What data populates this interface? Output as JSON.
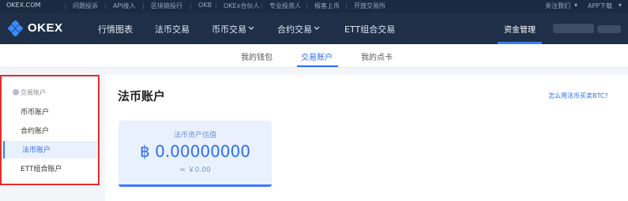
{
  "topbar": {
    "brand": "OKEX.COM",
    "links": [
      "问题投诉",
      "API接入",
      "区块链投行",
      "OKB",
      "OKEx合伙人",
      "专业投资人",
      "极客上币",
      "开放交易所"
    ],
    "follow": "关注我们",
    "app_download": "APP下载"
  },
  "navbar": {
    "logo_text": "OKEX",
    "items": [
      {
        "label": "行情图表"
      },
      {
        "label": "法币交易"
      },
      {
        "label": "币币交易"
      },
      {
        "label": "合约交易"
      },
      {
        "label": "ETT组合交易"
      }
    ],
    "funds_label": "资金管理"
  },
  "subnav": {
    "tabs": [
      {
        "label": "我的钱包"
      },
      {
        "label": "交易账户"
      },
      {
        "label": "我的点卡"
      }
    ],
    "active_tab": "交易账户"
  },
  "sidebar": {
    "header": "交易账户",
    "items": [
      {
        "label": "币币账户"
      },
      {
        "label": "合约账户"
      },
      {
        "label": "法币账户"
      },
      {
        "label": "ETT组合账户"
      }
    ],
    "active_item": "法币账户",
    "highlight_color": "#e52b2b"
  },
  "main": {
    "title": "法币账户",
    "help_link": "怎么用法币买卖BTC?",
    "card": {
      "label": "法币资产估值",
      "value": "฿ 0.00000000",
      "sub": "≈ ￥0.00"
    }
  },
  "colors": {
    "accent": "#2d6df6",
    "nav_bg": "#1f2f48",
    "topbar_bg": "#1b2a41"
  }
}
